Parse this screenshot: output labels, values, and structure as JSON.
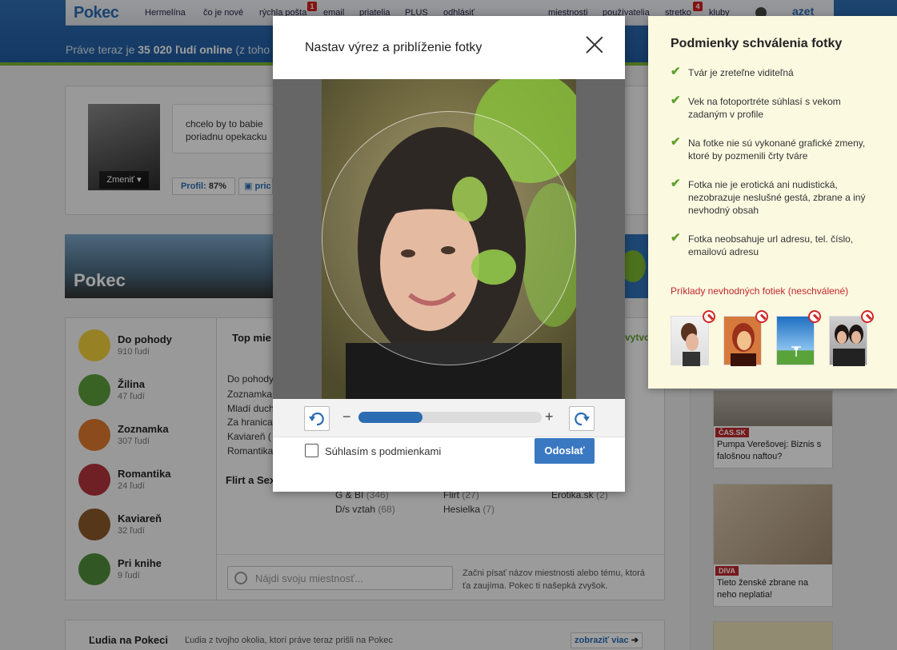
{
  "header": {
    "logo": "Pokec",
    "nav_left": [
      "Hermelína",
      "čo je nové",
      "rýchla pošta",
      "email",
      "priatelia",
      "PLUS",
      "odhlásiť"
    ],
    "mail_badge": "1",
    "nav_right": [
      "miestnosti",
      "používatelia",
      "stretko",
      "kluby"
    ],
    "stretko_badge": "4",
    "azet_logo": "azet",
    "online_prefix": "Práve teraz je",
    "online_count": "35 020 ľudí online",
    "online_suffix": "(z toho"
  },
  "profile": {
    "change_label": "Zmeniť",
    "status_line1": "chcelo by to babie",
    "status_line2": "poriadnu opekacku",
    "profile_label": "Profil:",
    "profile_value": "87%",
    "second_button": "pric"
  },
  "banner": {
    "word": "Pokec"
  },
  "rooms": [
    {
      "name": "Do pohody",
      "count": "910 ľudí",
      "color": "#f3d23c"
    },
    {
      "name": "Žilina",
      "count": "47 ľudí",
      "color": "#5c9f3c"
    },
    {
      "name": "Zoznamka",
      "count": "307 ľudí",
      "color": "#e27a2e"
    },
    {
      "name": "Romantika",
      "count": "24 ľudí",
      "color": "#b4343b"
    },
    {
      "name": "Kaviareň",
      "count": "32 ľudí",
      "color": "#8b5a2b"
    },
    {
      "name": "Pri knihe",
      "count": "9 ľudí",
      "color": "#4f8e3a"
    }
  ],
  "rooms_main": {
    "tab_label": "Top mie",
    "right_link": "vytvor",
    "links": [
      "Do pohody",
      "Zoznamka",
      "Mladí duch",
      "Za hranica",
      "Kaviareň (",
      "Romantika"
    ],
    "flirt_title": "Flirt a Sex",
    "row1": [
      {
        "name": "G & BI",
        "count": "(346)"
      },
      {
        "name": "Flirt",
        "count": "(27)"
      },
      {
        "name": "Erotika.sk",
        "count": "(2)"
      }
    ],
    "row2": [
      {
        "name": "D/s vztah",
        "count": "(68)"
      },
      {
        "name": "Hesielka",
        "count": "(7)"
      }
    ],
    "search_placeholder": "Nájdi svoju miestnosť...",
    "search_hint": "Začni písať názov miestnosti alebo tému, ktorá ťa zaujíma. Pokec ti našepká zvyšok."
  },
  "people": {
    "title": "Ľudia na Pokeci",
    "subtitle": "Ľudia z tvojho okolia, ktorí práve teraz prišli na Pokec",
    "more": "zobraziť viac"
  },
  "news": [
    {
      "tag": "ČAS.SK",
      "title": "Pumpa Verešovej: Biznis s falošnou naftou?"
    },
    {
      "tag": "DIVA",
      "title": "Tieto ženské zbrane na neho neplatia!"
    }
  ],
  "modal": {
    "title": "Nastav výrez a priblíženie fotky",
    "zoom_minus": "−",
    "zoom_plus": "+",
    "zoom_level": 0.35,
    "agree_label": "Súhlasím s podmienkami",
    "send_label": "Odoslať"
  },
  "conditions": {
    "title": "Podmienky schválenia fotky",
    "items": [
      "Tvár je zreteľne viditeľná",
      "Vek na fotoportréte súhlasí s vekom zadaným v profile",
      "Na fotke nie sú vykonané grafické zmeny, ktoré by pozmenili črty tváre",
      "Fotka nie je erotická ani nudistická, nezobrazuje neslušné gestá, zbrane a iný nevhodný obsah",
      "Fotka neobsahuje url adresu, tel. číslo, emailovú adresu"
    ],
    "examples_link": "Príklady nevhodných fotiek (neschválené)"
  },
  "colors": {
    "brand_blue": "#2b6cb3",
    "accent_green": "#7cb82f",
    "ban_red": "#d12828"
  }
}
